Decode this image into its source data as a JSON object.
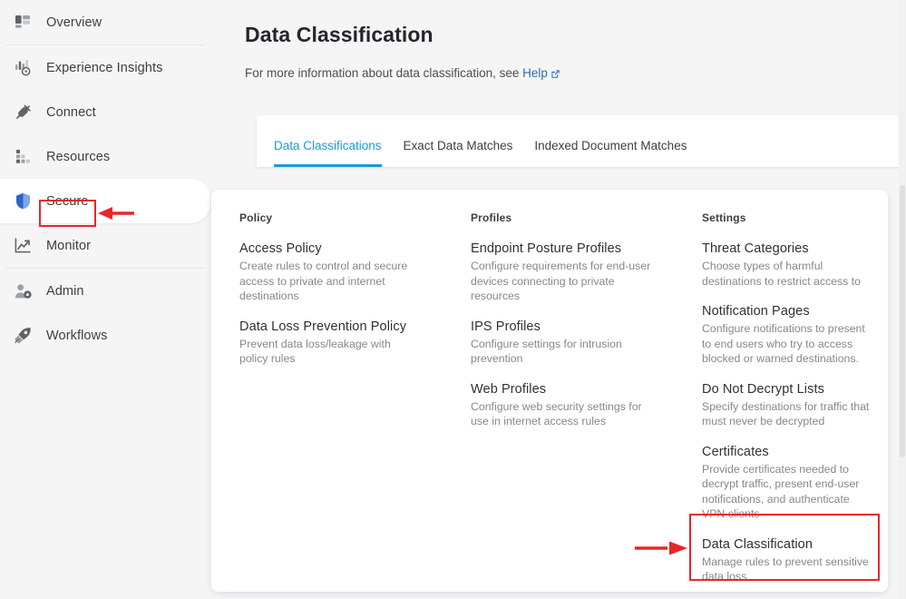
{
  "sidebar": {
    "items": [
      {
        "label": "Overview",
        "icon": "dashboard-grid-icon",
        "active": false,
        "divider_after": true
      },
      {
        "label": "Experience Insights",
        "icon": "insights-chart-icon",
        "active": false,
        "divider_after": false
      },
      {
        "label": "Connect",
        "icon": "plug-connect-icon",
        "active": false,
        "divider_after": false
      },
      {
        "label": "Resources",
        "icon": "resources-blocks-icon",
        "active": false,
        "divider_after": false
      },
      {
        "label": "Secure",
        "icon": "shield-icon",
        "active": true,
        "divider_after": false
      },
      {
        "label": "Monitor",
        "icon": "line-chart-icon",
        "active": false,
        "divider_after": true
      },
      {
        "label": "Admin",
        "icon": "user-gear-icon",
        "active": false,
        "divider_after": false
      },
      {
        "label": "Workflows",
        "icon": "rocket-icon",
        "active": false,
        "divider_after": false
      }
    ]
  },
  "header": {
    "title": "Data Classification",
    "subtitle_prefix": "For more information about data classification, see ",
    "help_label": "Help",
    "help_icon": "external-link-icon"
  },
  "tabs": [
    {
      "label": "Data Classifications",
      "selected": true
    },
    {
      "label": "Exact Data Matches",
      "selected": false
    },
    {
      "label": "Indexed Document Matches",
      "selected": false
    }
  ],
  "mega_menu": {
    "columns": [
      {
        "heading": "Policy",
        "entries": [
          {
            "title": "Access Policy",
            "desc": "Create rules to control and secure access to private and internet destinations"
          },
          {
            "title": "Data Loss Prevention Policy",
            "desc": "Prevent data loss/leakage with policy rules"
          }
        ]
      },
      {
        "heading": "Profiles",
        "entries": [
          {
            "title": "Endpoint Posture Profiles",
            "desc": "Configure requirements for end-user devices connecting to private resources"
          },
          {
            "title": "IPS Profiles",
            "desc": "Configure settings for intrusion prevention"
          },
          {
            "title": "Web Profiles",
            "desc": "Configure web security settings for use in internet access rules"
          }
        ]
      },
      {
        "heading": "Settings",
        "entries": [
          {
            "title": "Threat Categories",
            "desc": "Choose types of harmful destinations to restrict access to"
          },
          {
            "title": "Notification Pages",
            "desc": "Configure notifications to present to end users who try to access blocked or warned destinations."
          },
          {
            "title": "Do Not Decrypt Lists",
            "desc": "Specify destinations for traffic that must never be decrypted"
          },
          {
            "title": "Certificates",
            "desc": "Provide certificates needed to decrypt traffic, present end-user notifications, and authenticate VPN clients"
          },
          {
            "title": "Data Classification",
            "desc": "Manage rules to prevent sensitive data loss"
          }
        ]
      }
    ]
  },
  "annotations": {
    "color": "#e8262a",
    "highlight_secure": "Secure",
    "highlight_data_classification": "Data Classification"
  },
  "colors": {
    "accent_blue": "#1b9ad6",
    "link_blue": "#2b6cb8",
    "background": "#f5f5f6",
    "panel": "#ffffff",
    "annotation_red": "#e8262a",
    "shield_blue": "#3a6fd8"
  }
}
